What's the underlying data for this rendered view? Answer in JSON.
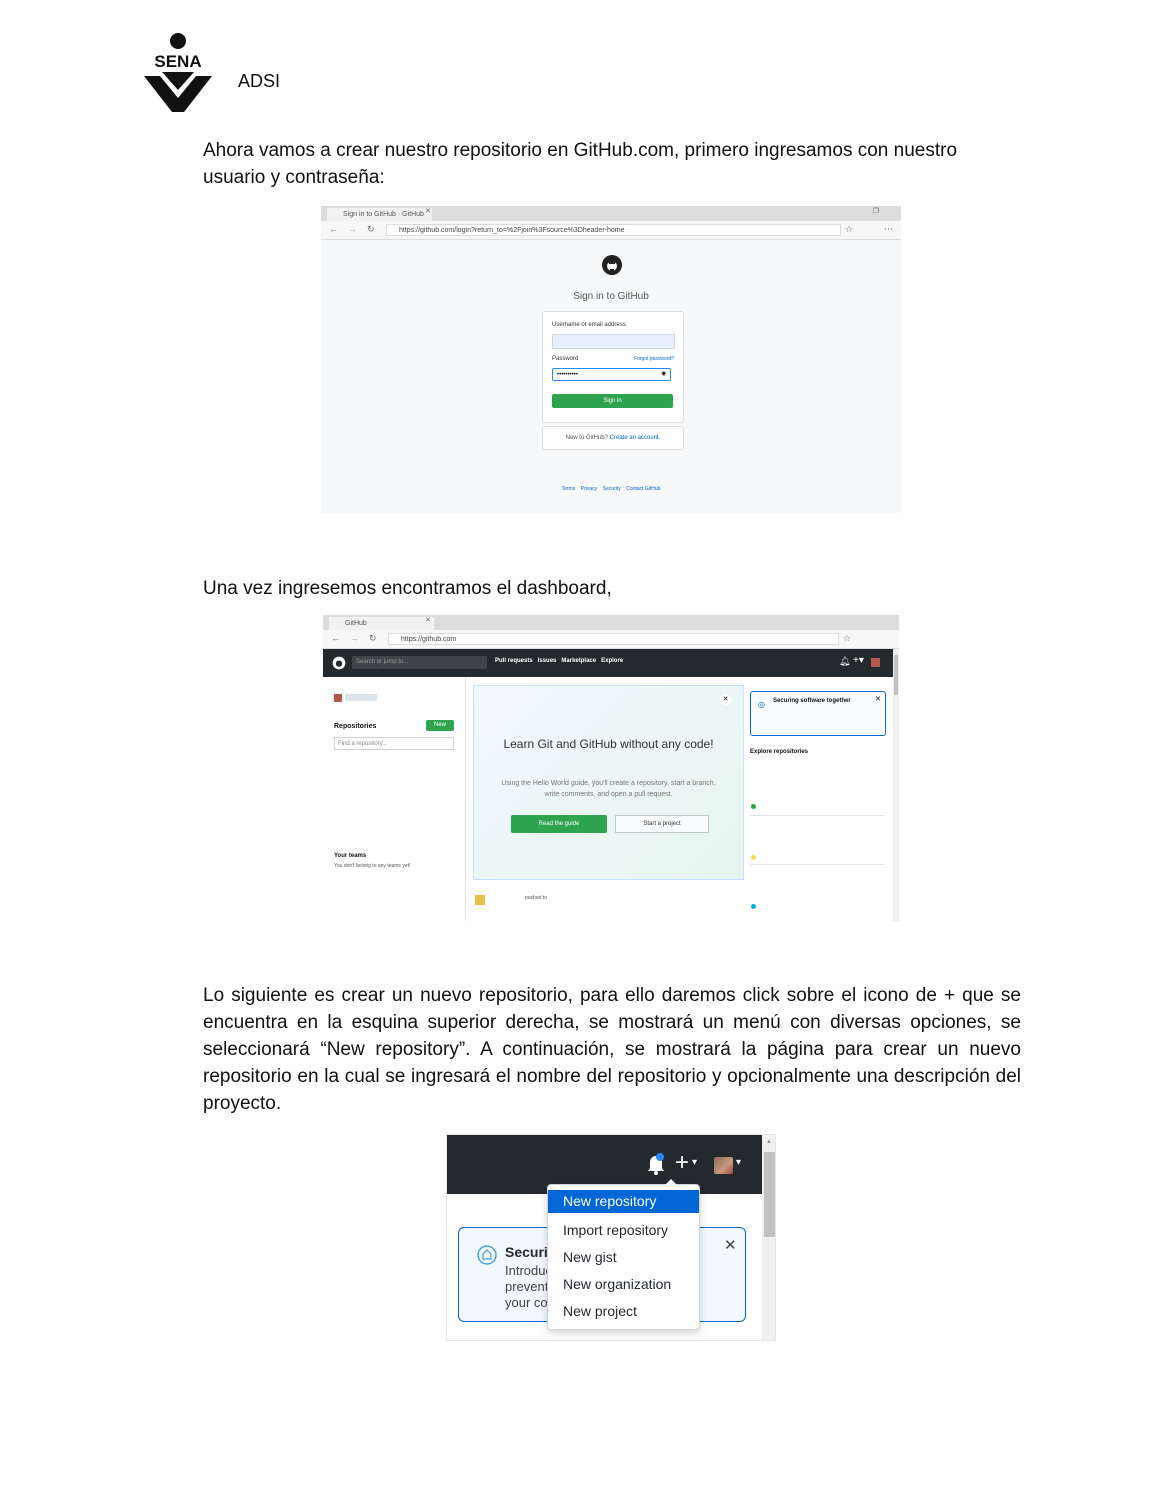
{
  "header": {
    "logo_text": "SENA",
    "program": "ADSI"
  },
  "paragraphs": {
    "p1": "Ahora vamos a crear nuestro repositorio en GitHub.com, primero ingresamos con nuestro usuario y contraseña:",
    "p2": "Una vez ingresemos encontramos el dashboard,",
    "p3": "Lo siguiente es crear un nuevo repositorio, para ello daremos click sobre el icono de + que se encuentra en la esquina superior derecha, se mostrará un menú con diversas opciones, se seleccionará “New repository”. A continuación, se mostrará la página para crear un nuevo repositorio en la cual se ingresará el nombre del repositorio y opcionalmente una descripción del proyecto."
  },
  "shot1": {
    "tab_title": "Sign in to GitHub · GitHub",
    "url": "https://github.com/login?return_to=%2Fjoin%3Fsource%3Dheader-home",
    "heading": "Sign in to GitHub",
    "username_label": "Username or email address",
    "password_label": "Password",
    "forgot_label": "Forgot password?",
    "password_value": "••••••••••",
    "signin_button": "Sign in",
    "new_to_github": "New to GitHub?",
    "create_account": "Create an account.",
    "footer_links": [
      "Terms",
      "Privacy",
      "Security",
      "Contact GitHub"
    ]
  },
  "shot2": {
    "tab_title": "GitHub",
    "url": "https://github.com",
    "search_placeholder": "Search or jump to...",
    "nav": [
      "Pull requests",
      "Issues",
      "Marketplace",
      "Explore"
    ],
    "repositories_label": "Repositories",
    "new_button": "New",
    "find_repo_placeholder": "Find a repository...",
    "teams_title": "Your teams",
    "teams_text": "You don't belong to any teams yet!",
    "learn_title": "Learn Git and GitHub without any code!",
    "learn_text": "Using the Hello World guide, you'll create a repository, start a branch, write comments, and open a pull request.",
    "read_guide": "Read the guide",
    "start_project": "Start a project",
    "securing_title": "Securing software together",
    "explore_title": "Explore repositories",
    "feed_text": "pushed to"
  },
  "shot3": {
    "menu_items": [
      "New repository",
      "Import repository",
      "New gist",
      "New organization",
      "New project"
    ],
    "card_lines": [
      "Securin",
      "Introduc",
      "prevent",
      "your co"
    ],
    "close_icon_glyph": "✕",
    "plus_glyph": "+",
    "caret_glyph": "▾"
  },
  "colors": {
    "github_dark": "#24292e",
    "github_green": "#2ea44f",
    "menu_highlight": "#0366d6",
    "card_border": "#0366d6"
  }
}
